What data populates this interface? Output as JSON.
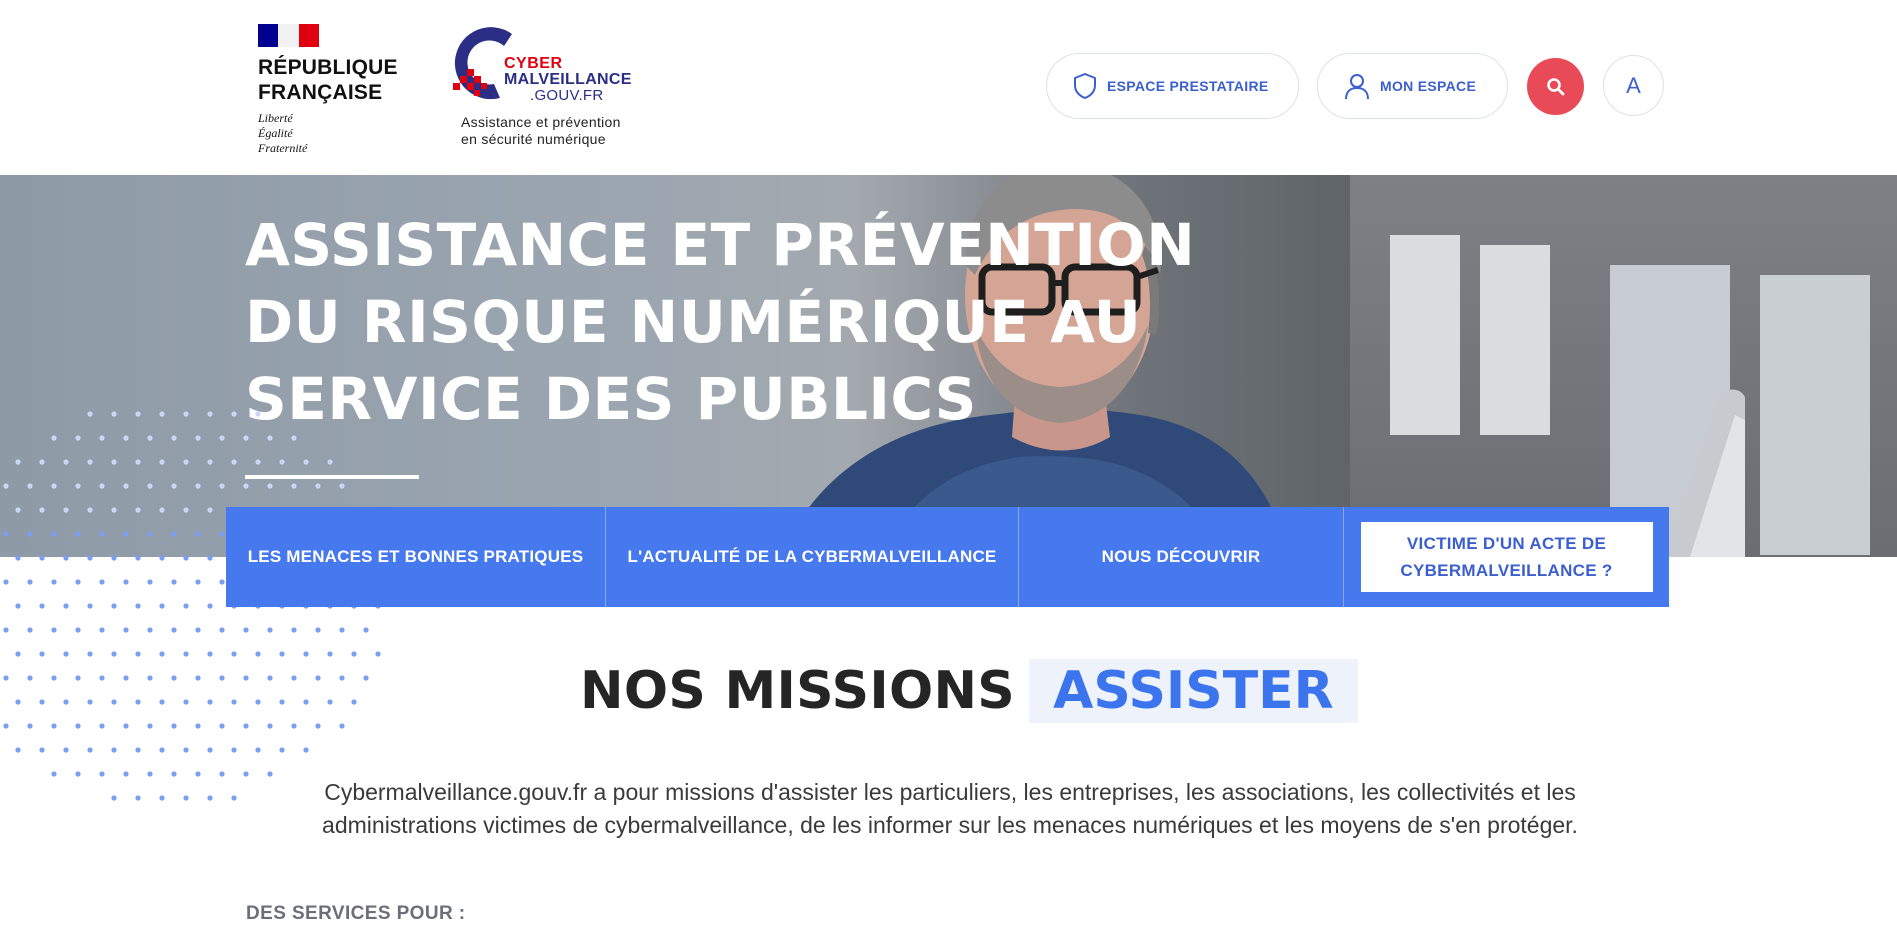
{
  "header": {
    "rf": {
      "name_line1": "RÉPUBLIQUE",
      "name_line2": "FRANÇAISE",
      "motto_1": "Liberté",
      "motto_2": "Égalité",
      "motto_3": "Fraternité"
    },
    "cm": {
      "word1": "CYBER",
      "word2": "MALVEILLANCE",
      "word3": ".GOUV.FR",
      "tagline_1": "Assistance et prévention",
      "tagline_2": "en sécurité numérique"
    },
    "buttons": {
      "presta_label": "ESPACE PRESTATAIRE",
      "espace_label": "MON ESPACE",
      "font_toggle_label": "A"
    },
    "icons": {
      "presta": "shield-icon",
      "espace": "user-icon",
      "search": "search-icon"
    },
    "colors": {
      "accent": "#3c5fd0",
      "search_bg": "#e84a57"
    }
  },
  "hero": {
    "title_line1": "ASSISTANCE ET PRÉVENTION",
    "title_line2": "DU RISQUE NUMÉRIQUE AU",
    "title_line3": "SERVICE DES PUBLICS"
  },
  "nav": {
    "items": [
      {
        "label": "LES MENACES ET BONNES PRATIQUES"
      },
      {
        "label": "L'ACTUALITÉ DE LA CYBERMALVEILLANCE"
      },
      {
        "label": "NOUS DÉCOUVRIR"
      }
    ],
    "cta_line1": "VICTIME D'UN ACTE DE",
    "cta_line2": "CYBERMALVEILLANCE ?",
    "bg_color": "#4779ee"
  },
  "missions": {
    "title": "NOS MISSIONS",
    "tag": "ASSISTER",
    "description_line1": "Cybermalveillance.gouv.fr a pour missions d'assister les particuliers, les entreprises, les associations, les collectivités et les",
    "description_line2": "administrations victimes de cybermalveillance, de les informer sur les menaces numériques et les moyens de s'en protéger.",
    "services_heading": "DES SERVICES POUR :"
  }
}
